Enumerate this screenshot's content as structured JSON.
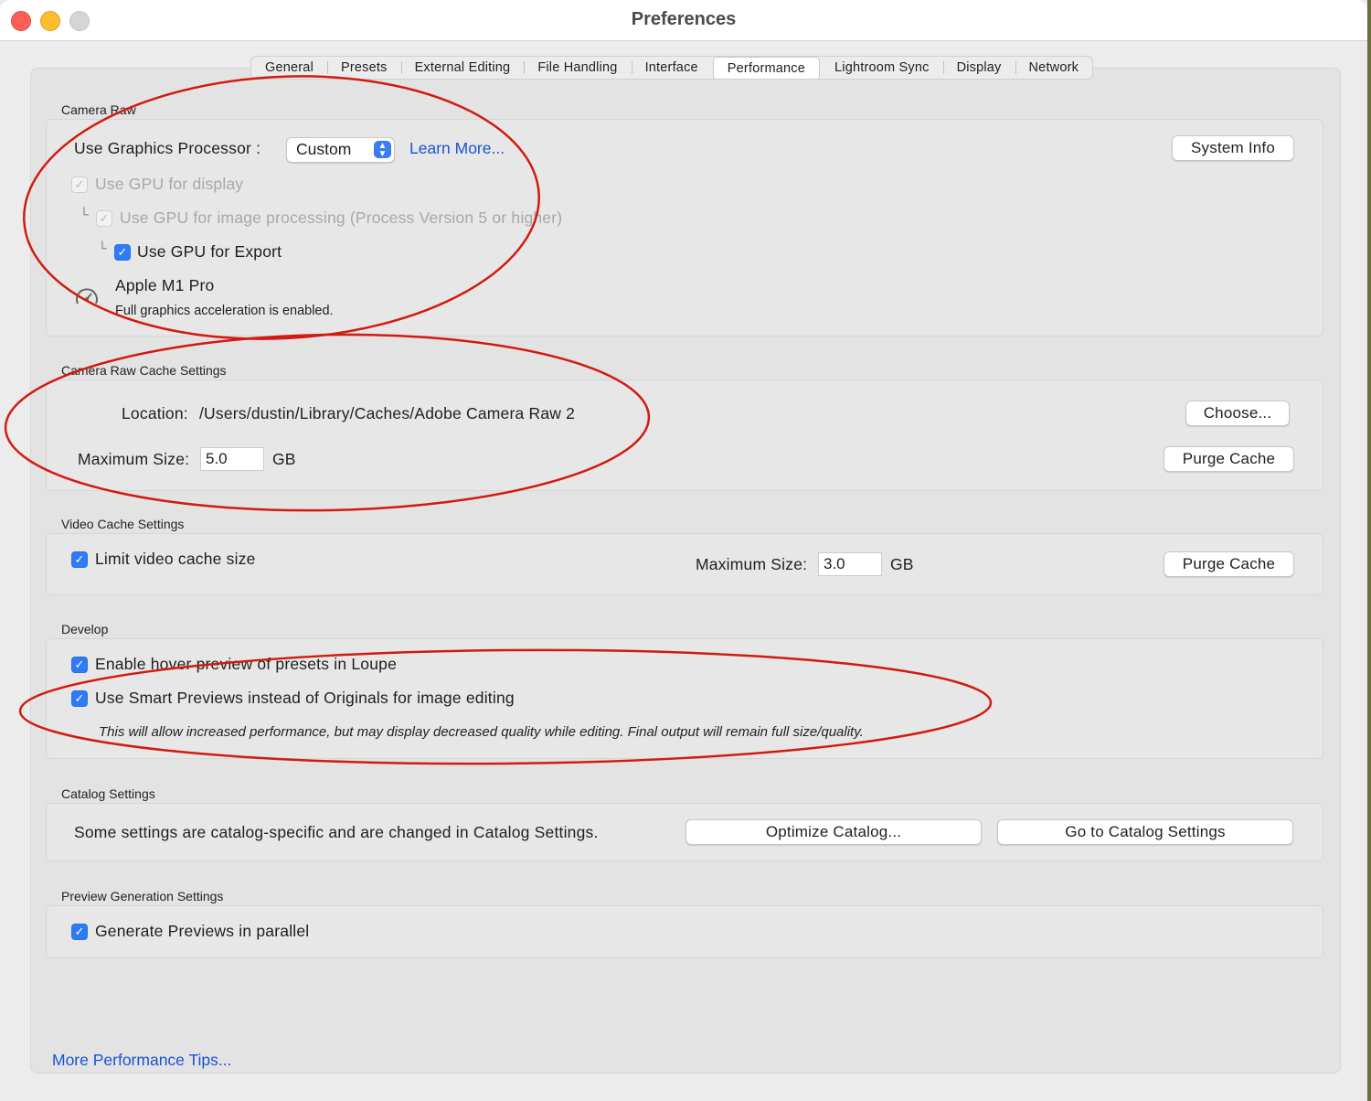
{
  "window": {
    "title": "Preferences"
  },
  "tabs": [
    {
      "label": "General"
    },
    {
      "label": "Presets"
    },
    {
      "label": "External Editing"
    },
    {
      "label": "File Handling"
    },
    {
      "label": "Interface"
    },
    {
      "label": "Performance",
      "active": true
    },
    {
      "label": "Lightroom Sync"
    },
    {
      "label": "Display"
    },
    {
      "label": "Network"
    }
  ],
  "camera_raw": {
    "section_label": "Camera Raw",
    "gpu_label": "Use Graphics Processor :",
    "gpu_value": "Custom",
    "learn_more": "Learn More...",
    "system_info_button": "System Info",
    "use_gpu_display": "Use GPU for display",
    "use_gpu_processing": "Use GPU for image processing (Process Version 5 or higher)",
    "use_gpu_export": "Use GPU for Export",
    "gpu_name": "Apple M1 Pro",
    "gpu_status": "Full graphics acceleration is enabled."
  },
  "camera_raw_cache": {
    "section_label": "Camera Raw Cache Settings",
    "location_label": "Location:",
    "location_value": "/Users/dustin/Library/Caches/Adobe Camera Raw 2",
    "choose_button": "Choose...",
    "max_size_label": "Maximum Size:",
    "max_size_value": "5.0",
    "unit": "GB",
    "purge_button": "Purge Cache"
  },
  "video_cache": {
    "section_label": "Video Cache Settings",
    "limit_label": "Limit video cache size",
    "max_size_label": "Maximum Size:",
    "max_size_value": "3.0",
    "unit": "GB",
    "purge_button": "Purge Cache"
  },
  "develop": {
    "section_label": "Develop",
    "hover_preview": "Enable hover preview of presets in Loupe",
    "smart_previews": "Use Smart Previews instead of Originals for image editing",
    "smart_previews_note": "This will allow increased performance, but may display decreased quality while editing. Final output will remain full size/quality."
  },
  "catalog": {
    "section_label": "Catalog Settings",
    "description": "Some settings are catalog-specific and are changed in Catalog Settings.",
    "optimize_button": "Optimize Catalog...",
    "goto_button": "Go to Catalog Settings"
  },
  "preview_generation": {
    "section_label": "Preview Generation Settings",
    "parallel": "Generate Previews in parallel"
  },
  "footer": {
    "tips_link": "More Performance Tips..."
  },
  "checkmark_glyph": "✓",
  "colors": {
    "accent": "#2f7bf5",
    "link": "#1b52d4",
    "annotation": "#d21a10"
  }
}
